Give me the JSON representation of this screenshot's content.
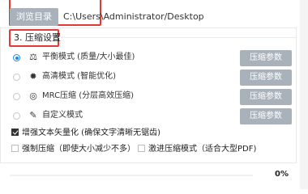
{
  "output_dir": {
    "browse_label": "浏览目录",
    "path": "C:\\Users\\Administrator/Desktop"
  },
  "compression": {
    "section_title": "3. 压缩设置",
    "modes": [
      {
        "icon": "balance-icon",
        "glyph": "⚖",
        "label": "平衡模式 (质量/大小最佳)",
        "checked": true,
        "button": "压缩参数"
      },
      {
        "icon": "sun-icon",
        "glyph": "✹",
        "label": "高清模式 (智能优化)",
        "checked": false,
        "button": "压缩参数"
      },
      {
        "icon": "mrc-icon",
        "glyph": "◎",
        "label": "MRC压缩 (分层高效压缩)",
        "checked": false,
        "button": "压缩参数"
      },
      {
        "icon": "custom-icon",
        "glyph": "✎",
        "label": "自定义模式",
        "checked": false,
        "button": "压缩参数"
      }
    ],
    "options": {
      "vectorize_label": "增强文本矢量化 (确保文字清晰无锯齿)",
      "vectorize_checked": true,
      "force_label": "强制压缩（即使大小减少不多）",
      "force_checked": false,
      "aggressive_label": "激进压缩模式（适合大型PDF)",
      "aggressive_checked": false
    }
  },
  "progress": {
    "percent_text": "0%",
    "value": 0
  }
}
